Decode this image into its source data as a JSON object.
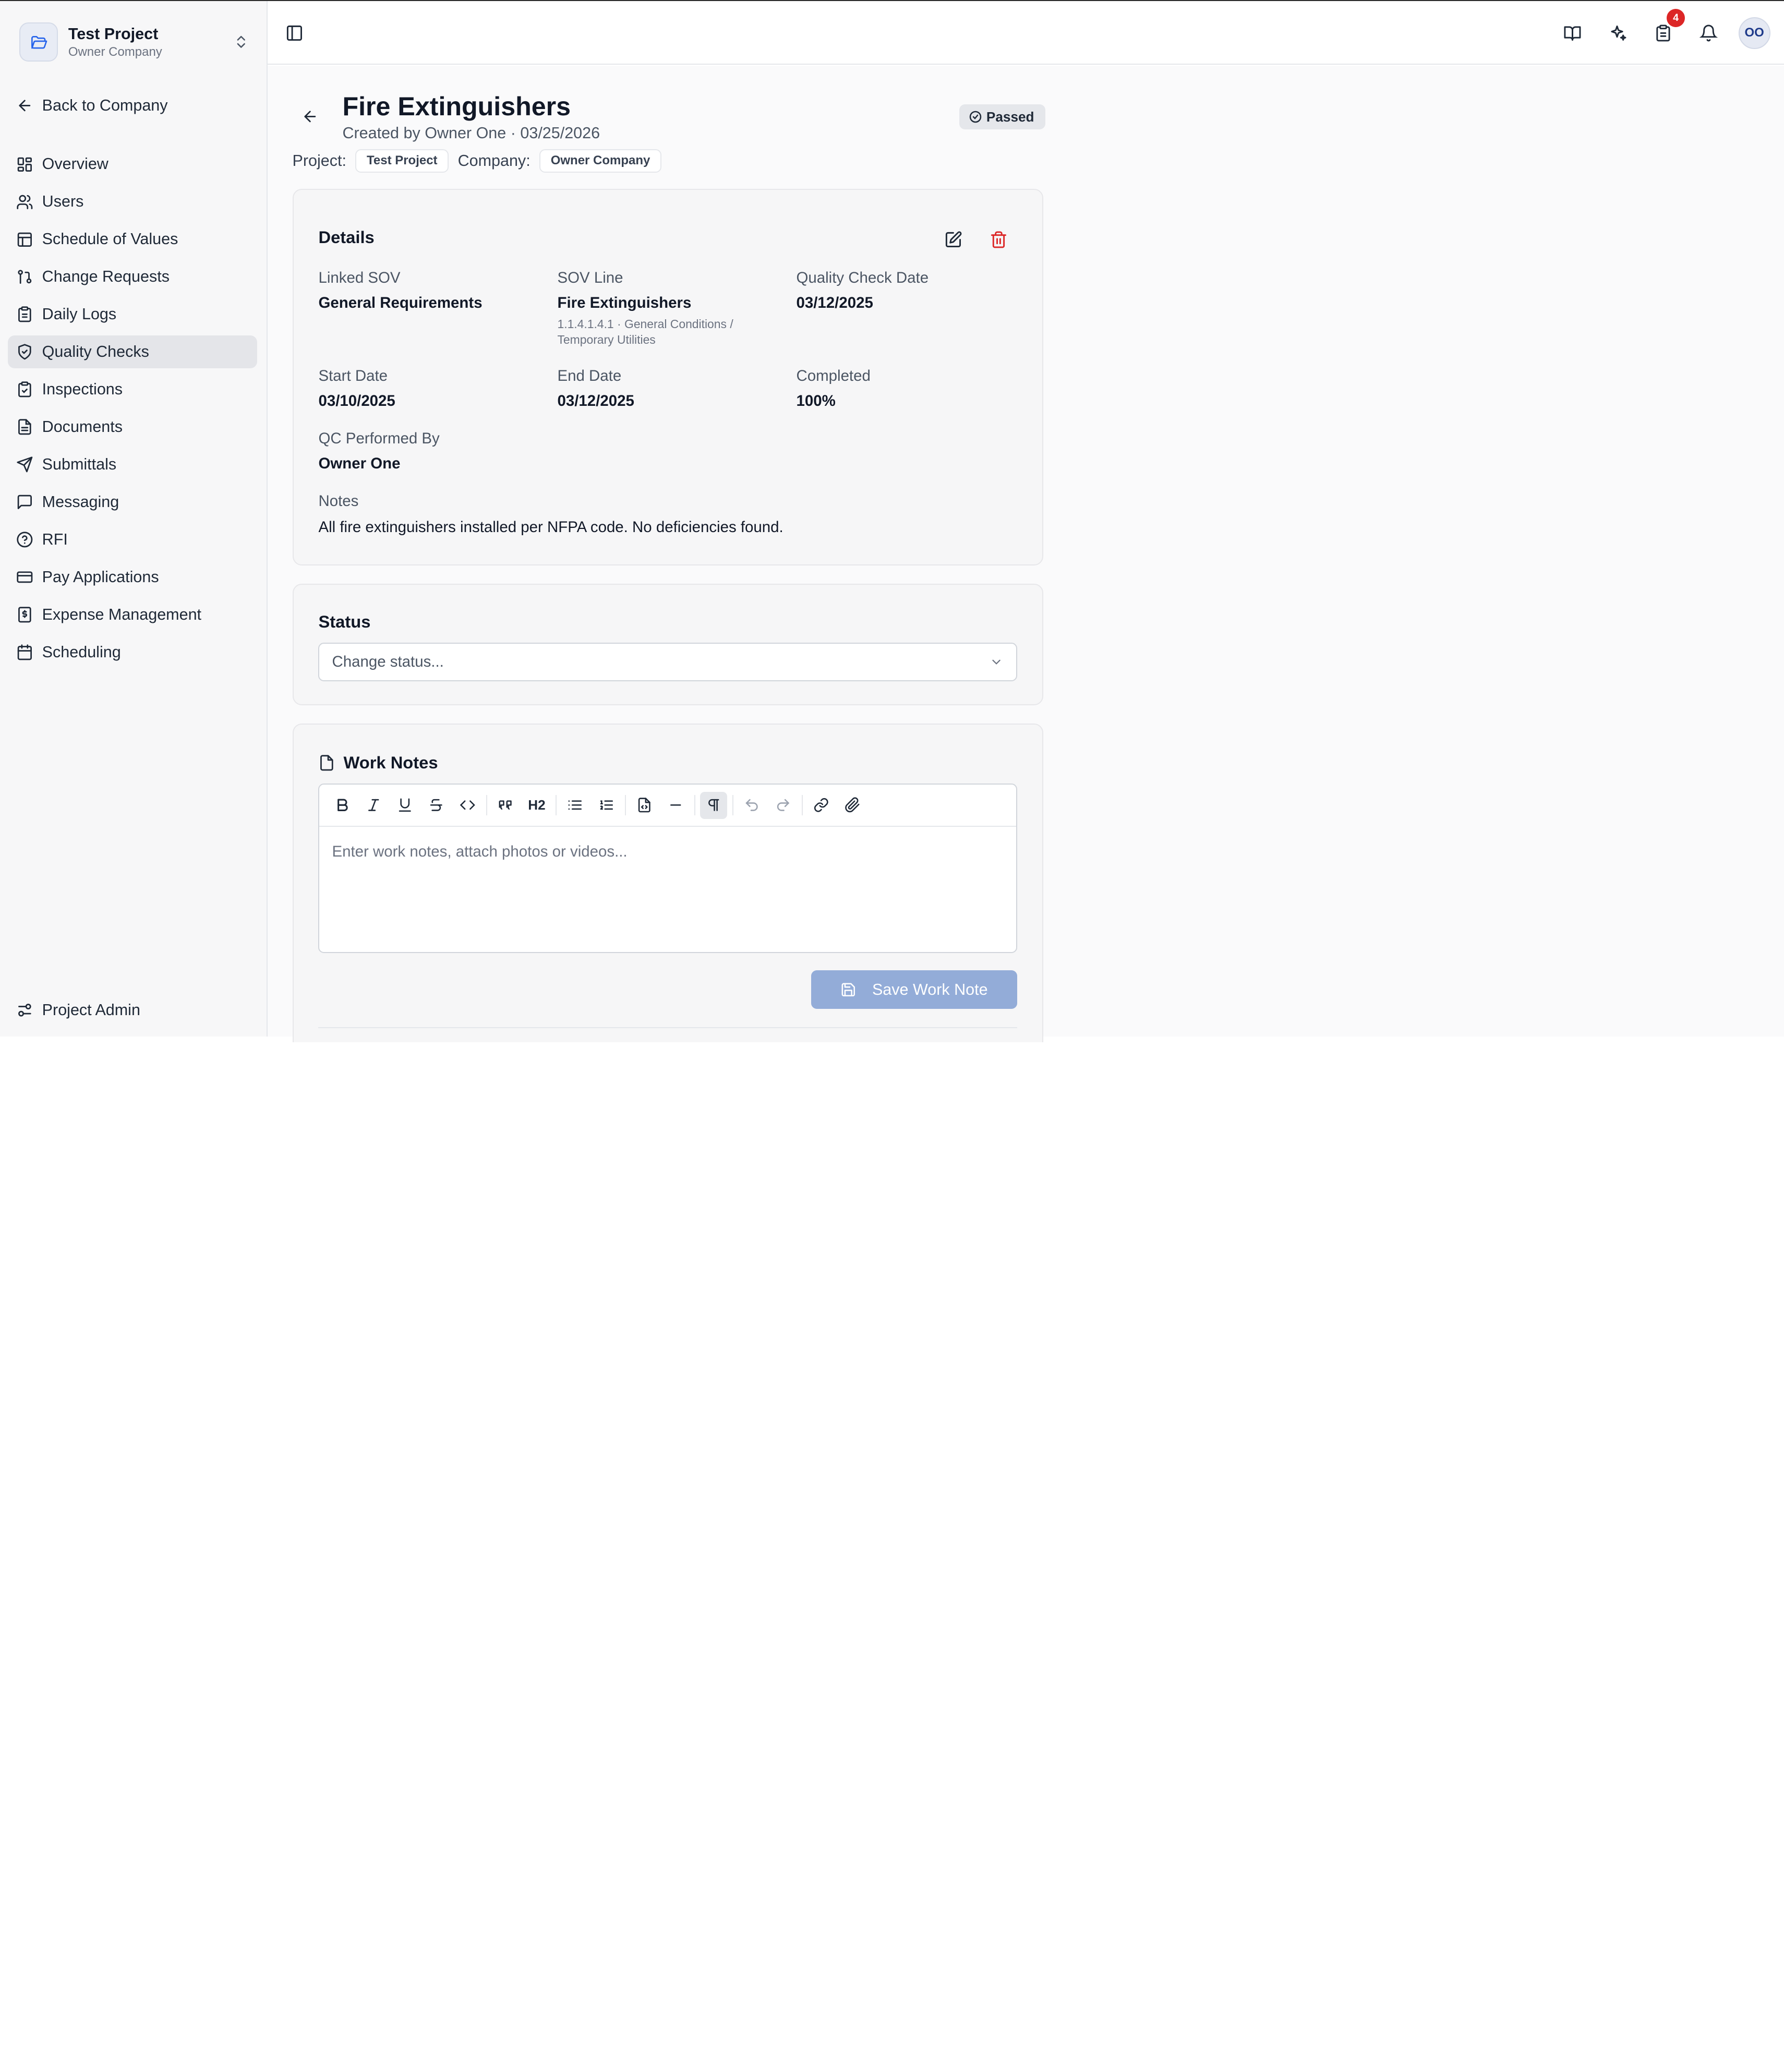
{
  "project_switcher": {
    "name": "Test Project",
    "company": "Owner Company"
  },
  "sidebar": {
    "back_label": "Back to Company",
    "items": [
      {
        "label": "Overview",
        "icon": "dashboard-icon",
        "active": false
      },
      {
        "label": "Users",
        "icon": "users-icon",
        "active": false
      },
      {
        "label": "Schedule of Values",
        "icon": "table-icon",
        "active": false
      },
      {
        "label": "Change Requests",
        "icon": "git-pull-request-icon",
        "active": false
      },
      {
        "label": "Daily Logs",
        "icon": "clipboard-icon",
        "active": false
      },
      {
        "label": "Quality Checks",
        "icon": "shield-check-icon",
        "active": true
      },
      {
        "label": "Inspections",
        "icon": "clipboard-check-icon",
        "active": false
      },
      {
        "label": "Documents",
        "icon": "file-text-icon",
        "active": false
      },
      {
        "label": "Submittals",
        "icon": "send-icon",
        "active": false
      },
      {
        "label": "Messaging",
        "icon": "message-icon",
        "active": false
      },
      {
        "label": "RFI",
        "icon": "help-circle-icon",
        "active": false
      },
      {
        "label": "Pay Applications",
        "icon": "credit-card-icon",
        "active": false
      },
      {
        "label": "Expense Management",
        "icon": "receipt-icon",
        "active": false
      },
      {
        "label": "Scheduling",
        "icon": "calendar-icon",
        "active": false
      }
    ],
    "admin_label": "Project Admin"
  },
  "topbar": {
    "tasks_badge": "4",
    "avatar_initials": "OO"
  },
  "page": {
    "title": "Fire Extinguishers",
    "subtitle": "Created by Owner One · 03/25/2026",
    "status": "Passed",
    "project_label": "Project:",
    "project_value": "Test Project",
    "company_label": "Company:",
    "company_value": "Owner Company"
  },
  "details": {
    "heading": "Details",
    "linked_sov_label": "Linked SOV",
    "linked_sov_value": "General Requirements",
    "sov_line_label": "SOV Line",
    "sov_line_value": "Fire Extinguishers",
    "sov_line_sub": "1.1.4.1.4.1 · General Conditions / Temporary Utilities",
    "qc_date_label": "Quality Check Date",
    "qc_date_value": "03/12/2025",
    "start_label": "Start Date",
    "start_value": "03/10/2025",
    "end_label": "End Date",
    "end_value": "03/12/2025",
    "completed_label": "Completed",
    "completed_value": "100%",
    "performed_label": "QC Performed By",
    "performed_value": "Owner One",
    "notes_label": "Notes",
    "notes_value": "All fire extinguishers installed per NFPA code. No deficiencies found."
  },
  "status_card": {
    "heading": "Status",
    "placeholder": "Change status..."
  },
  "work_notes": {
    "heading": "Work Notes",
    "placeholder": "Enter work notes, attach photos or videos...",
    "save_label": "Save Work Note",
    "toolbar_heading_label": "H2"
  },
  "colors": {
    "accent_disabled": "#93acd8",
    "danger": "#dc2626",
    "active_nav": "#e4e5e9"
  }
}
